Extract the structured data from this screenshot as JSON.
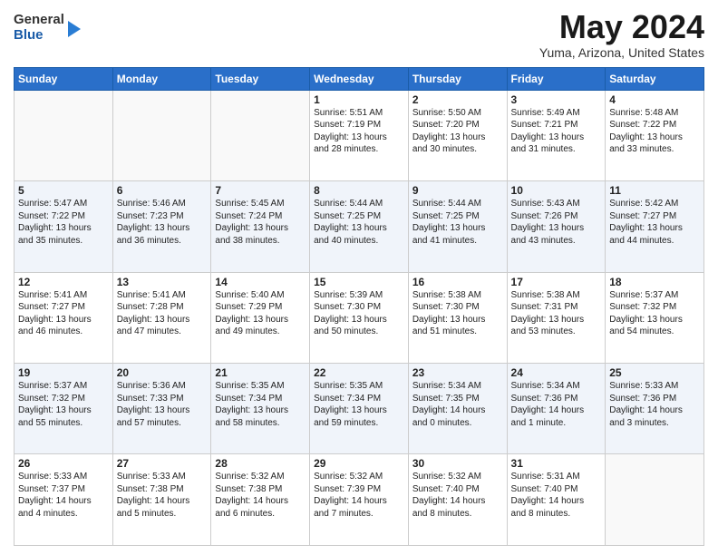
{
  "logo": {
    "general": "General",
    "blue": "Blue"
  },
  "title": "May 2024",
  "location": "Yuma, Arizona, United States",
  "headers": [
    "Sunday",
    "Monday",
    "Tuesday",
    "Wednesday",
    "Thursday",
    "Friday",
    "Saturday"
  ],
  "weeks": [
    [
      {
        "day": "",
        "lines": []
      },
      {
        "day": "",
        "lines": []
      },
      {
        "day": "",
        "lines": []
      },
      {
        "day": "1",
        "lines": [
          "Sunrise: 5:51 AM",
          "Sunset: 7:19 PM",
          "Daylight: 13 hours",
          "and 28 minutes."
        ]
      },
      {
        "day": "2",
        "lines": [
          "Sunrise: 5:50 AM",
          "Sunset: 7:20 PM",
          "Daylight: 13 hours",
          "and 30 minutes."
        ]
      },
      {
        "day": "3",
        "lines": [
          "Sunrise: 5:49 AM",
          "Sunset: 7:21 PM",
          "Daylight: 13 hours",
          "and 31 minutes."
        ]
      },
      {
        "day": "4",
        "lines": [
          "Sunrise: 5:48 AM",
          "Sunset: 7:22 PM",
          "Daylight: 13 hours",
          "and 33 minutes."
        ]
      }
    ],
    [
      {
        "day": "5",
        "lines": [
          "Sunrise: 5:47 AM",
          "Sunset: 7:22 PM",
          "Daylight: 13 hours",
          "and 35 minutes."
        ]
      },
      {
        "day": "6",
        "lines": [
          "Sunrise: 5:46 AM",
          "Sunset: 7:23 PM",
          "Daylight: 13 hours",
          "and 36 minutes."
        ]
      },
      {
        "day": "7",
        "lines": [
          "Sunrise: 5:45 AM",
          "Sunset: 7:24 PM",
          "Daylight: 13 hours",
          "and 38 minutes."
        ]
      },
      {
        "day": "8",
        "lines": [
          "Sunrise: 5:44 AM",
          "Sunset: 7:25 PM",
          "Daylight: 13 hours",
          "and 40 minutes."
        ]
      },
      {
        "day": "9",
        "lines": [
          "Sunrise: 5:44 AM",
          "Sunset: 7:25 PM",
          "Daylight: 13 hours",
          "and 41 minutes."
        ]
      },
      {
        "day": "10",
        "lines": [
          "Sunrise: 5:43 AM",
          "Sunset: 7:26 PM",
          "Daylight: 13 hours",
          "and 43 minutes."
        ]
      },
      {
        "day": "11",
        "lines": [
          "Sunrise: 5:42 AM",
          "Sunset: 7:27 PM",
          "Daylight: 13 hours",
          "and 44 minutes."
        ]
      }
    ],
    [
      {
        "day": "12",
        "lines": [
          "Sunrise: 5:41 AM",
          "Sunset: 7:27 PM",
          "Daylight: 13 hours",
          "and 46 minutes."
        ]
      },
      {
        "day": "13",
        "lines": [
          "Sunrise: 5:41 AM",
          "Sunset: 7:28 PM",
          "Daylight: 13 hours",
          "and 47 minutes."
        ]
      },
      {
        "day": "14",
        "lines": [
          "Sunrise: 5:40 AM",
          "Sunset: 7:29 PM",
          "Daylight: 13 hours",
          "and 49 minutes."
        ]
      },
      {
        "day": "15",
        "lines": [
          "Sunrise: 5:39 AM",
          "Sunset: 7:30 PM",
          "Daylight: 13 hours",
          "and 50 minutes."
        ]
      },
      {
        "day": "16",
        "lines": [
          "Sunrise: 5:38 AM",
          "Sunset: 7:30 PM",
          "Daylight: 13 hours",
          "and 51 minutes."
        ]
      },
      {
        "day": "17",
        "lines": [
          "Sunrise: 5:38 AM",
          "Sunset: 7:31 PM",
          "Daylight: 13 hours",
          "and 53 minutes."
        ]
      },
      {
        "day": "18",
        "lines": [
          "Sunrise: 5:37 AM",
          "Sunset: 7:32 PM",
          "Daylight: 13 hours",
          "and 54 minutes."
        ]
      }
    ],
    [
      {
        "day": "19",
        "lines": [
          "Sunrise: 5:37 AM",
          "Sunset: 7:32 PM",
          "Daylight: 13 hours",
          "and 55 minutes."
        ]
      },
      {
        "day": "20",
        "lines": [
          "Sunrise: 5:36 AM",
          "Sunset: 7:33 PM",
          "Daylight: 13 hours",
          "and 57 minutes."
        ]
      },
      {
        "day": "21",
        "lines": [
          "Sunrise: 5:35 AM",
          "Sunset: 7:34 PM",
          "Daylight: 13 hours",
          "and 58 minutes."
        ]
      },
      {
        "day": "22",
        "lines": [
          "Sunrise: 5:35 AM",
          "Sunset: 7:34 PM",
          "Daylight: 13 hours",
          "and 59 minutes."
        ]
      },
      {
        "day": "23",
        "lines": [
          "Sunrise: 5:34 AM",
          "Sunset: 7:35 PM",
          "Daylight: 14 hours",
          "and 0 minutes."
        ]
      },
      {
        "day": "24",
        "lines": [
          "Sunrise: 5:34 AM",
          "Sunset: 7:36 PM",
          "Daylight: 14 hours",
          "and 1 minute."
        ]
      },
      {
        "day": "25",
        "lines": [
          "Sunrise: 5:33 AM",
          "Sunset: 7:36 PM",
          "Daylight: 14 hours",
          "and 3 minutes."
        ]
      }
    ],
    [
      {
        "day": "26",
        "lines": [
          "Sunrise: 5:33 AM",
          "Sunset: 7:37 PM",
          "Daylight: 14 hours",
          "and 4 minutes."
        ]
      },
      {
        "day": "27",
        "lines": [
          "Sunrise: 5:33 AM",
          "Sunset: 7:38 PM",
          "Daylight: 14 hours",
          "and 5 minutes."
        ]
      },
      {
        "day": "28",
        "lines": [
          "Sunrise: 5:32 AM",
          "Sunset: 7:38 PM",
          "Daylight: 14 hours",
          "and 6 minutes."
        ]
      },
      {
        "day": "29",
        "lines": [
          "Sunrise: 5:32 AM",
          "Sunset: 7:39 PM",
          "Daylight: 14 hours",
          "and 7 minutes."
        ]
      },
      {
        "day": "30",
        "lines": [
          "Sunrise: 5:32 AM",
          "Sunset: 7:40 PM",
          "Daylight: 14 hours",
          "and 8 minutes."
        ]
      },
      {
        "day": "31",
        "lines": [
          "Sunrise: 5:31 AM",
          "Sunset: 7:40 PM",
          "Daylight: 14 hours",
          "and 8 minutes."
        ]
      },
      {
        "day": "",
        "lines": []
      }
    ]
  ]
}
